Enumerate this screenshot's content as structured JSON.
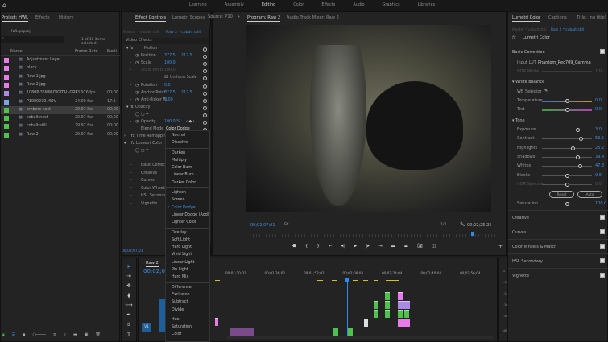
{
  "topbar": {
    "workspaces": [
      "Learning",
      "Assembly",
      "Editing",
      "Color",
      "Effects",
      "Audio",
      "Graphics",
      "Libraries"
    ],
    "active": "Editing"
  },
  "project": {
    "tabs": [
      "Project: HWL",
      "Effects",
      "History"
    ],
    "file": "HWL.prproj",
    "items_selected": "1 of 10 items selected",
    "columns": [
      "Name",
      "Frame Rate",
      "Medi"
    ],
    "items": [
      {
        "name": "Adjustment Layer",
        "fps": "",
        "media": "",
        "color": "#e77ce6"
      },
      {
        "name": "black",
        "fps": "",
        "media": "",
        "color": "#e77ce6"
      },
      {
        "name": "Raw 1.jpg",
        "fps": "",
        "media": "",
        "color": "#e77ce6"
      },
      {
        "name": "Raw 2.jpg",
        "fps": "",
        "media": "",
        "color": "#e77ce6"
      },
      {
        "name": "1080P-35MM-DIGITAL-GRA",
        "fps": "23.976 fps",
        "media": "00;00",
        "color": "#a98be6"
      },
      {
        "name": "P1000279.MOV",
        "fps": "24.00 fps",
        "media": "17:5",
        "color": "#7aa6e6"
      },
      {
        "name": "embers nest",
        "fps": "29.97 fps",
        "media": "00;00",
        "color": "#4fc14f"
      },
      {
        "name": "cobalt nest",
        "fps": "29.97 fps",
        "media": "00;00",
        "color": "#4fc14f"
      },
      {
        "name": "cobalt still",
        "fps": "29.97 fps",
        "media": "00;00",
        "color": "#4fc14f"
      },
      {
        "name": "Raw 2",
        "fps": "29.97 fps",
        "media": "00;00",
        "color": "#4fc14f"
      }
    ],
    "selected_index": 6
  },
  "effect_controls": {
    "tabs": [
      "Effect Controls",
      "Lumetri Scopes",
      "Source: P10"
    ],
    "master": "Master * cobalt still",
    "sequence": "Raw 2 * cobalt still",
    "timecode": "00;02;08;04",
    "clip_label": "cobalt still",
    "section": "Video Effects",
    "motion": "Motion",
    "position_x": "377.5",
    "position_y": "212.5",
    "scale_label": "Scale",
    "scale": "100.0",
    "scale_width_label": "Scale Width",
    "scale_width": "100.0",
    "uniform_scale": "Uniform Scale",
    "rotation_label": "Rotation",
    "rotation": "0.0",
    "anchor_label": "Anchor Point",
    "anchor_x": "377.5",
    "anchor_y": "212.5",
    "antiflicker_label": "Anti-flicker Fi...",
    "antiflicker": "0.00",
    "position_label": "Position",
    "opacity_section": "Opacity",
    "opacity_label": "Opacity",
    "opacity": "100.0 %",
    "blend_label": "Blend Mode",
    "blend": "Color Dodge",
    "time_remap": "Time Remapping",
    "lumetri": "Lumetri Color",
    "lumetri_subs": [
      "Basic Correction",
      "Creative",
      "Curves",
      "Color Wheels & ...",
      "HSL Secondary",
      "Vignette"
    ],
    "footer_time": "00;02;07;01"
  },
  "blend_menu": {
    "groups": [
      [
        "Normal",
        "Dissolve"
      ],
      [
        "Darken",
        "Multiply",
        "Color Burn",
        "Linear Burn",
        "Darker Color"
      ],
      [
        "Lighten",
        "Screen",
        "Color Dodge",
        "Linear Dodge (Add)",
        "Lighter Color"
      ],
      [
        "Overlay",
        "Soft Light",
        "Hard Light",
        "Vivid Light",
        "Linear Light",
        "Pin Light",
        "Hard Mix"
      ],
      [
        "Difference",
        "Exclusion",
        "Subtract",
        "Divide"
      ],
      [
        "Hue",
        "Saturation",
        "Color"
      ]
    ],
    "selected": "Color Dodge"
  },
  "program": {
    "tabs": [
      "Program: Raw 2",
      "Audio Track Mixer: Raw 2"
    ],
    "timecode": "00;02;07;01",
    "fit": "Fit",
    "resolution": "1/2",
    "duration": "00;02;25;25",
    "playhead_fraction": 0.88
  },
  "timeline": {
    "tab": "Raw 2",
    "timecode": "00;02;07;",
    "ruler": [
      "00;01;20;02",
      "00;01;36;02",
      "00;01;52;02",
      "00;02;08;04",
      "00;02;24;04",
      "00;02;40;04",
      "00;02;56;04"
    ],
    "track": "V1",
    "meter_labels": [
      "0",
      "-12",
      "-24",
      "-36",
      "-48",
      "-dB"
    ]
  },
  "lumetri": {
    "tabs": [
      "Lumetri Color",
      "Captions",
      "Title: (no title)"
    ],
    "master": "Master * cobalt still",
    "sequence": "Raw 2 * cobalt still",
    "effect": "Lumetri Color",
    "basic": "Basic Correction",
    "input_lut_label": "Input LUT",
    "input_lut": "Phantom_Rec709_Gamma",
    "hdr_white": "HDR White",
    "hdr_white_val": "100",
    "white_balance": "White Balance",
    "wb_selector": "WB Selector",
    "sliders_wb": [
      {
        "label": "Temperature",
        "value": "0.0",
        "pos": 0.5
      },
      {
        "label": "Tint",
        "value": "0.0",
        "pos": 0.5
      }
    ],
    "tone": "Tone",
    "sliders_tone": [
      {
        "label": "Exposure",
        "value": "3.0",
        "pos": 0.72
      },
      {
        "label": "Contrast",
        "value": "53.5",
        "pos": 0.79
      },
      {
        "label": "Highlights",
        "value": "25.2",
        "pos": 0.62
      },
      {
        "label": "Shadows",
        "value": "39.4",
        "pos": 0.72
      },
      {
        "label": "Whites",
        "value": "47.3",
        "pos": 0.76
      },
      {
        "label": "Blacks",
        "value": "0.6",
        "pos": 0.5
      },
      {
        "label": "HDR Specular",
        "value": "0.0",
        "pos": 0.5
      }
    ],
    "reset": "Reset",
    "auto": "Auto",
    "saturation": {
      "label": "Saturation",
      "value": "100.0",
      "pos": 0.5
    },
    "sections": [
      "Creative",
      "Curves",
      "Color Wheels & Match",
      "HSL Secondary",
      "Vignette"
    ]
  },
  "colors": {
    "accent": "#2d8ceb",
    "clip_green": "#4fc14f",
    "clip_pink": "#e77ce6",
    "clip_purple": "#a98be6"
  }
}
